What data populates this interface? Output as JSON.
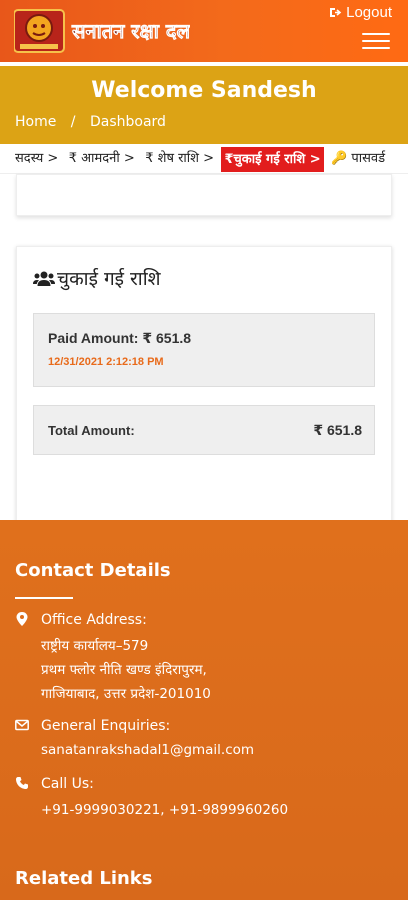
{
  "header": {
    "logo_text": "सनातन रक्षा दल",
    "logout_label": "Logout"
  },
  "welcome": {
    "title": "Welcome Sandesh",
    "breadcrumb": [
      "Home",
      "/",
      "Dashboard"
    ]
  },
  "tabs": [
    {
      "label": "सदस्य >",
      "active": false
    },
    {
      "label": "₹ आमदनी >",
      "active": false
    },
    {
      "label": "₹ शेष राशि >",
      "active": false
    },
    {
      "label": "₹चुकाई गई राशि >",
      "active": true
    },
    {
      "label": "🔑 पासवर्ड",
      "active": false
    }
  ],
  "paid_section": {
    "title": "चुकाई गई राशि",
    "paid_line": "Paid Amount: ₹ 651.8",
    "paid_date": "12/31/2021 2:12:18 PM",
    "total_label": "Total Amount:",
    "total_value": "₹ 651.8"
  },
  "footer": {
    "contact_heading": "Contact Details",
    "office_label": "Office Address:",
    "office_lines": [
      "राष्ट्रीय कार्यालय–579",
      "प्रथम फ्लोर नीति खण्ड इंदिरापुरम,",
      "गाजियाबाद, उत्तर प्रदेश-201010"
    ],
    "enquiry_label": "General Enquiries:",
    "enquiry_email": "sanatanrakshadal1@gmail.com",
    "call_label": "Call Us:",
    "call_numbers": "+91-9999030221, +91-9899960260",
    "related_heading": "Related Links"
  },
  "colors": {
    "header_orange": "#f36a1b",
    "welcome_gold": "#dca315",
    "active_tab_red": "#e21d1d",
    "footer_orange": "#dc6d1b",
    "date_orange": "#e86a1a"
  },
  "icons": [
    "logo-emblem",
    "logout-icon",
    "menu-icon",
    "users-icon",
    "map-marker-icon",
    "envelope-icon",
    "phone-icon",
    "key-icon"
  ]
}
